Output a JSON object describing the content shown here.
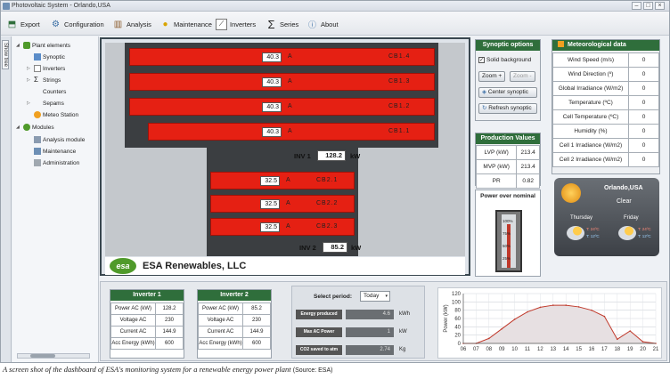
{
  "window": {
    "title": "Photovoltaic System - Orlando,USA"
  },
  "toolbar": {
    "items": [
      {
        "label": "Export",
        "icon": "export-icon"
      },
      {
        "label": "Configuration",
        "icon": "gear-icon"
      },
      {
        "label": "Analysis",
        "icon": "chart-icon"
      },
      {
        "label": "Maintenance",
        "icon": "bulb-icon"
      },
      {
        "label": "Inverters",
        "icon": "inverter-icon"
      },
      {
        "label": "Series",
        "icon": "sigma-icon"
      },
      {
        "label": "About",
        "icon": "info-icon"
      }
    ]
  },
  "side_tab": "Show tree",
  "tree": {
    "plant_elements": "Plant elements",
    "synoptic": "Synoptic",
    "inverters": "Inverters",
    "strings": "Strings",
    "counters": "Counters",
    "separators": "Sepams",
    "meteo_station": "Meteo Station",
    "modules": "Modules",
    "analysis_module": "Analysis module",
    "maintenance": "Maintenance",
    "administration": "Administration"
  },
  "synoptic": {
    "cb_unit": "A",
    "inv1_bars": [
      {
        "value": "40.3",
        "label": "CB1.4"
      },
      {
        "value": "40.3",
        "label": "CB1.3"
      },
      {
        "value": "40.3",
        "label": "CB1.2"
      },
      {
        "value": "40.3",
        "label": "CB1.1"
      }
    ],
    "inv1": {
      "label": "INV 1",
      "value": "128.2",
      "unit": "kW"
    },
    "inv2_bars": [
      {
        "value": "32.5",
        "label": "CB2.1"
      },
      {
        "value": "32.5",
        "label": "CB2.2"
      },
      {
        "value": "32.5",
        "label": "CB2.3"
      }
    ],
    "inv2": {
      "label": "INV 2",
      "value": "85.2",
      "unit": "kW"
    }
  },
  "brand": {
    "logo": "esa",
    "name": "ESA Renewables, LLC"
  },
  "synoptic_options": {
    "title": "Synoptic options",
    "solid_background": "Solid background",
    "solid_background_checked": true,
    "zoom_in": "Zoom +",
    "zoom_out": "Zoom -",
    "center": "Center synoptic",
    "refresh": "Refresh synoptic"
  },
  "production": {
    "title": "Production Values",
    "rows": [
      {
        "label": "LVP (kW)",
        "value": "213.4"
      },
      {
        "label": "MVP (kW)",
        "value": "213.4"
      },
      {
        "label": "PR",
        "value": "0.82"
      }
    ]
  },
  "power_nominal": {
    "title": "Power over nominal",
    "ticks": [
      "100%",
      "75%",
      "50%",
      "25%"
    ],
    "level": 0.82
  },
  "meteo": {
    "title": "Meteorological data",
    "rows": [
      {
        "label": "Wind Speed (m/s)",
        "value": "0"
      },
      {
        "label": "Wind Direction (º)",
        "value": "0"
      },
      {
        "label": "Global Irradiance (W/m2)",
        "value": "0"
      },
      {
        "label": "Temperature (ºC)",
        "value": "0"
      },
      {
        "label": "Cell Temperature (ºC)",
        "value": "0"
      },
      {
        "label": "Humidity (%)",
        "value": "0"
      },
      {
        "label": "Cell 1 Irradiance (W/m2)",
        "value": "0"
      },
      {
        "label": "Cell 2 Irradiance (W/m2)",
        "value": "0"
      }
    ]
  },
  "weather": {
    "city": "Orlando,USA",
    "condition": "Clear",
    "day1": "Thursday",
    "day1_high": "T: 24ºC",
    "day1_low": "T: 12ºC",
    "day2": "Friday",
    "day2_high": "T: 24ºC",
    "day2_low": "T: 12ºC"
  },
  "inverter1": {
    "title": "Inverter 1",
    "rows": [
      {
        "label": "Power AC (kW)",
        "value": "128.2"
      },
      {
        "label": "Voltage AC",
        "value": "230"
      },
      {
        "label": "Current AC",
        "value": "144.9"
      },
      {
        "label": "Acc Energy (kWh)",
        "value": "600"
      }
    ]
  },
  "inverter2": {
    "title": "Inverter 2",
    "rows": [
      {
        "label": "Power AC (kW)",
        "value": "85.2"
      },
      {
        "label": "Voltage AC",
        "value": "230"
      },
      {
        "label": "Current AC",
        "value": "144.9"
      },
      {
        "label": "Acc Energy (kWh)",
        "value": "600"
      }
    ]
  },
  "period": {
    "label": "Select period:",
    "selected": "Today",
    "rows": [
      {
        "label": "Energy produced",
        "value": "4.6",
        "unit": "kWh"
      },
      {
        "label": "Max AC Power",
        "value": "1",
        "unit": "kW"
      },
      {
        "label": "CO2 saved to atm",
        "value": "2.74",
        "unit": "Kg"
      }
    ]
  },
  "chart_data": {
    "type": "area",
    "title": "",
    "xlabel": "",
    "ylabel": "Power (kW)",
    "x": [
      "06",
      "07",
      "08",
      "09",
      "10",
      "11",
      "12",
      "13",
      "14",
      "15",
      "16",
      "17",
      "18",
      "19",
      "20",
      "21"
    ],
    "yticks": [
      "0",
      "20",
      "40",
      "60",
      "80",
      "100",
      "120"
    ],
    "ylim": [
      0,
      120
    ],
    "grid": true,
    "series": [
      {
        "values": [
          0,
          0,
          12,
          35,
          58,
          76,
          87,
          92,
          92,
          88,
          80,
          65,
          10,
          30,
          4,
          0
        ]
      }
    ],
    "colors": {
      "line": "#c0392b",
      "fill": "#e7e0e2"
    }
  },
  "caption": {
    "text": "A screen shot of the dashboard of ESA's monitoring system for a renewable energy power plant",
    "source": "(Source: ESA)"
  }
}
